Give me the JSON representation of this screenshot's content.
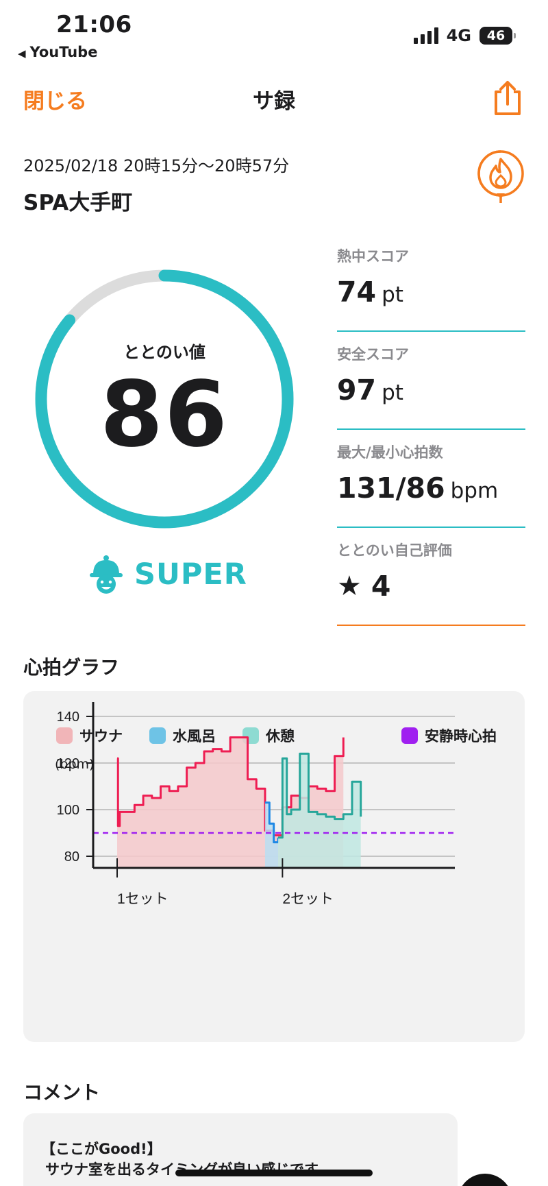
{
  "status_bar": {
    "time": "21:06",
    "back_app": "YouTube",
    "network": "4G",
    "battery": "46"
  },
  "nav": {
    "close": "閉じる",
    "title": "サ録"
  },
  "session": {
    "datetime": "2025/02/18 20時15分〜20時57分",
    "place": "SPA大手町"
  },
  "totonoi": {
    "label": "ととのい値",
    "value": "86",
    "score": 86,
    "max": 100,
    "rank": "SUPER"
  },
  "metrics": [
    {
      "label": "熱中スコア",
      "value": "74",
      "unit": "pt"
    },
    {
      "label": "安全スコア",
      "value": "97",
      "unit": "pt"
    },
    {
      "label": "最大/最小心拍数",
      "value": "131/86",
      "unit": "bpm"
    }
  ],
  "self_rating": {
    "label": "ととのい自己評価",
    "value": "4"
  },
  "heart_graph": {
    "title": "心拍グラフ",
    "legend": [
      {
        "label": "サウナ",
        "color": "#f1b5b8"
      },
      {
        "label": "水風呂",
        "color": "#6ec3e6"
      },
      {
        "label": "休憩",
        "color": "#8edbd2"
      },
      {
        "label": "安静時心拍",
        "color": "#a020f0"
      }
    ],
    "unit": "(bpm)"
  },
  "colors": {
    "accent_orange": "#f57c1f",
    "accent_teal": "#2bbdc4",
    "sauna_line": "#ee1d52",
    "water_line": "#1e88e5",
    "rest_line": "#26a69a"
  },
  "chart_data": {
    "type": "line",
    "ylabel": "(bpm)",
    "yticks": [
      80,
      100,
      120,
      140
    ],
    "ylim": [
      75,
      145
    ],
    "xlim": [
      0,
      37
    ],
    "x_ticks": [
      {
        "x": 0,
        "label": "1セット"
      },
      {
        "x": 19,
        "label": "2セット"
      }
    ],
    "resting_hr": 90,
    "grid": true,
    "series": [
      {
        "name": "サウナ",
        "color": "#ee1d52",
        "x": [
          0,
          0.1,
          0.3,
          1,
          2,
          3,
          4,
          5,
          6,
          7,
          8,
          9,
          10,
          11,
          12,
          13,
          14,
          15,
          16,
          17,
          18,
          19,
          20,
          21,
          22,
          23,
          24,
          25,
          26
        ],
        "y": [
          122,
          93,
          99,
          99,
          102,
          106,
          105,
          110,
          108,
          110,
          118,
          120,
          125,
          126,
          125,
          131,
          131,
          113,
          109,
          91,
          89,
          101,
          106,
          105,
          110,
          109,
          108,
          123,
          131
        ]
      },
      {
        "name": "水風呂",
        "color": "#1e88e5",
        "x": [
          17,
          17.5,
          18,
          18.5
        ],
        "y": [
          103,
          94,
          86,
          88
        ]
      },
      {
        "name": "休憩",
        "color": "#26a69a",
        "x": [
          18.5,
          19,
          19.5,
          20,
          21,
          22,
          23,
          24,
          25,
          26,
          27,
          28
        ],
        "y": [
          88,
          122,
          98,
          100,
          124,
          99,
          98,
          97,
          96,
          98,
          112,
          97
        ]
      }
    ]
  },
  "comment": {
    "title": "コメント",
    "heading": "【ここがGood!】",
    "body": "サウナ室を出るタイミングが良い感じです。"
  }
}
